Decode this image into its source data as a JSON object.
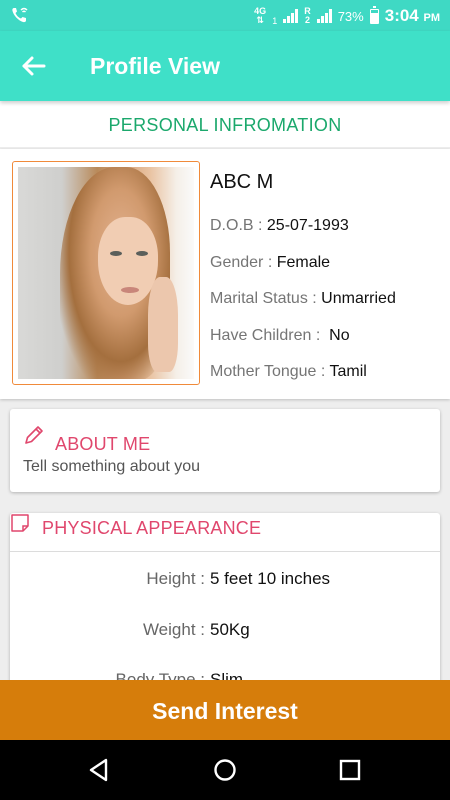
{
  "status_bar": {
    "network_label": "4G",
    "sim1_label": "1",
    "roaming_label": "R",
    "sim2_label": "2",
    "battery_percent": "73%",
    "time": "3:04",
    "time_suffix": "PM",
    "left_icon": "phone-wifi-call-icon"
  },
  "app_bar": {
    "title": "Profile View",
    "back_icon": "arrow-back-icon",
    "color": "#3fe0c8"
  },
  "personal": {
    "header": "PERSONAL INFROMATION",
    "name": "ABC  M",
    "rows": [
      {
        "label": "D.O.B : ",
        "value": "25-07-1993"
      },
      {
        "label": "Gender : ",
        "value": "Female"
      },
      {
        "label": "Marital Status : ",
        "value": "Unmarried"
      },
      {
        "label": "Have Children : ",
        "value": " No"
      },
      {
        "label": "Mother Tongue : ",
        "value": "Tamil"
      }
    ]
  },
  "about": {
    "title": "ABOUT ME",
    "icon": "pencil-icon",
    "text": "Tell something about you"
  },
  "physical": {
    "title": "PHYSICAL APPEARANCE",
    "icon": "note-icon",
    "rows": [
      {
        "label": "Height : ",
        "value": "5 feet 10 inches"
      },
      {
        "label": "Weight : ",
        "value": "50Kg"
      },
      {
        "label": "Body Type : ",
        "value": "Slim"
      }
    ]
  },
  "actions": {
    "send_interest": "Send Interest",
    "color": "#d67d0b"
  },
  "nav": {
    "back_icon": "nav-back-icon",
    "home_icon": "nav-home-icon",
    "recents_icon": "nav-recents-icon"
  },
  "colors": {
    "accent_green": "#1ba86c",
    "accent_pink": "#e0476d",
    "photo_border": "#f08a3a"
  }
}
